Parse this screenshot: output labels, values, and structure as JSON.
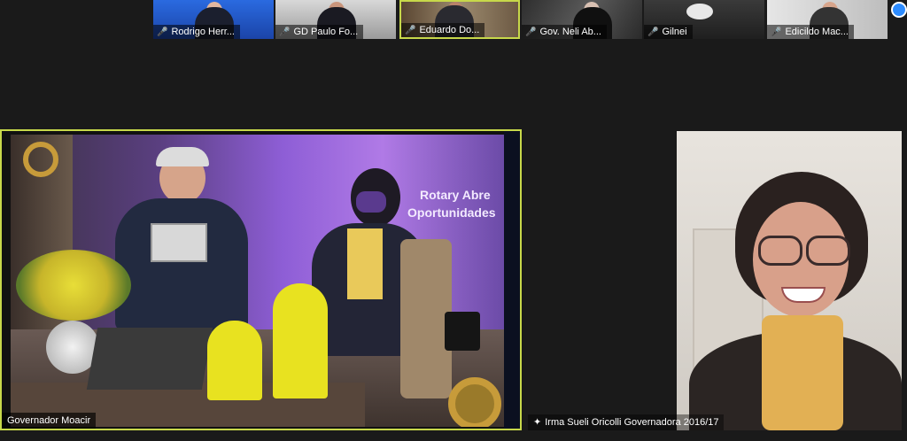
{
  "gallery": {
    "participants": [
      {
        "name": "Rodrigo Herr...",
        "muted": true
      },
      {
        "name": "GD Paulo Fo...",
        "muted": true
      },
      {
        "name": "Eduardo Do...",
        "muted": true
      },
      {
        "name": "Gov. Neli Ab...",
        "muted": true
      },
      {
        "name": "Gilnei",
        "muted": true
      },
      {
        "name": "Edicildo Mac...",
        "muted": true
      }
    ]
  },
  "main_video": {
    "name": "Governador Moacir",
    "banner_line1": "Rotary Abre",
    "banner_line2": "Oportunidades"
  },
  "secondary_video": {
    "name": "Irma Sueli Oricolli Governadora  2016/17",
    "pin_icon": "pin-icon"
  },
  "colors": {
    "active_speaker_border": "#c7d84a",
    "muted_icon": "#e5322d",
    "background": "#1a1a1a"
  }
}
